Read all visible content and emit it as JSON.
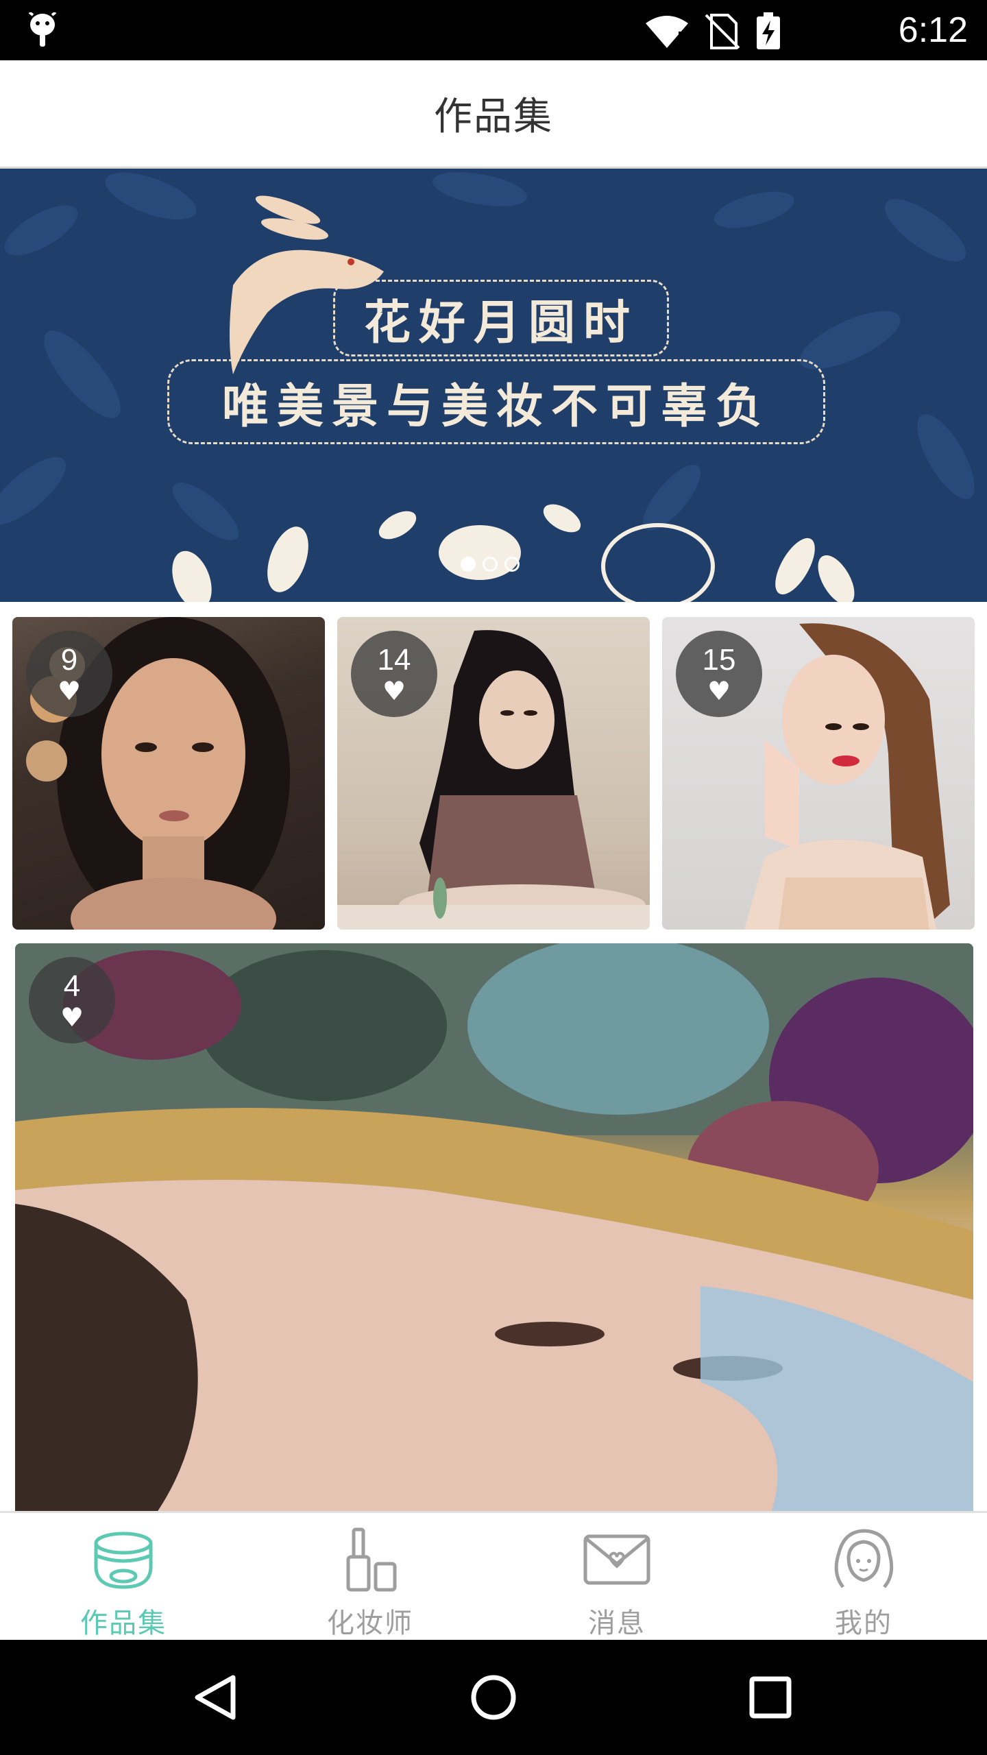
{
  "status_bar": {
    "time": "6:12",
    "icons": [
      "android-debug-icon",
      "wifi-icon",
      "no-sim-icon",
      "battery-charging-icon"
    ]
  },
  "header": {
    "title": "作品集"
  },
  "banner": {
    "line1": "花好月圆时",
    "line2": "唯美景与美妆不可辜负",
    "page_count": 3,
    "active_page": 1,
    "colors": {
      "background": "#1f3e6a",
      "cream": "#f3ead9"
    }
  },
  "gallery": {
    "items": [
      {
        "likes": "9"
      },
      {
        "likes": "14"
      },
      {
        "likes": "15"
      },
      {
        "likes": "4"
      }
    ]
  },
  "tabs": [
    {
      "label": "作品集",
      "icon": "compact-powder-icon",
      "active": true
    },
    {
      "label": "化妆师",
      "icon": "cosmetics-bottle-icon",
      "active": false
    },
    {
      "label": "消息",
      "icon": "envelope-heart-icon",
      "active": false
    },
    {
      "label": "我的",
      "icon": "woman-avatar-icon",
      "active": false
    }
  ],
  "theme": {
    "accent": "#5ccab3",
    "inactive": "#9e9e9e"
  }
}
